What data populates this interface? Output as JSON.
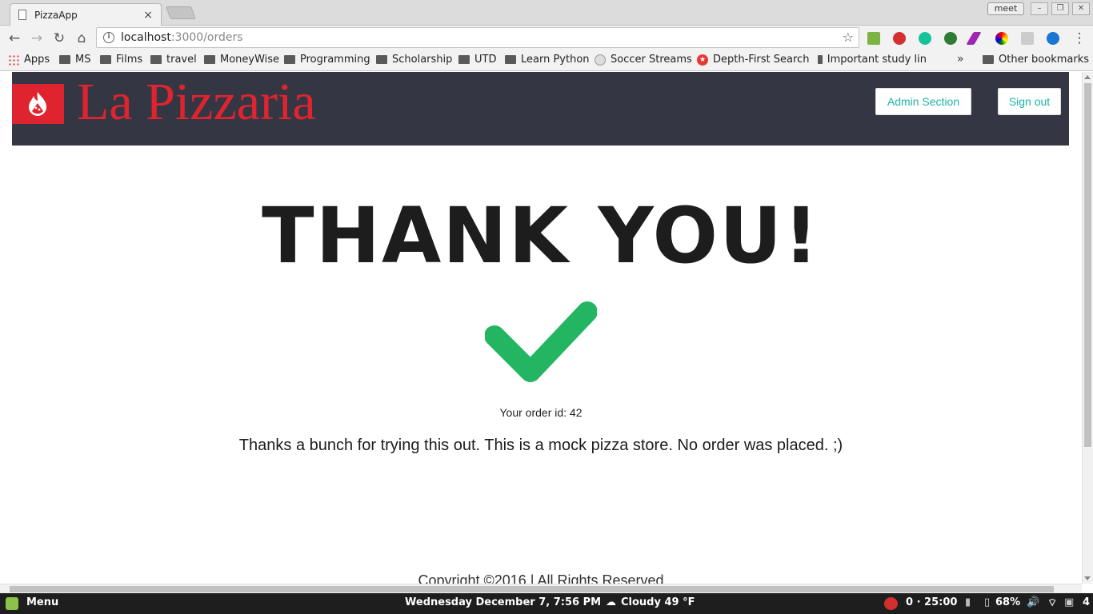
{
  "browser": {
    "tab_title": "PizzaApp",
    "tab_close": "×",
    "profile": "meet",
    "url_host": "localhost",
    "url_path": ":3000/orders",
    "bookmarks": [
      {
        "label": "Apps",
        "icon": "apps-icon"
      },
      {
        "label": "MS",
        "icon": "folder-icon"
      },
      {
        "label": "Films",
        "icon": "folder-icon"
      },
      {
        "label": "travel",
        "icon": "folder-icon"
      },
      {
        "label": "MoneyWise",
        "icon": "folder-icon"
      },
      {
        "label": "Programming",
        "icon": "folder-icon"
      },
      {
        "label": "Scholarship",
        "icon": "folder-icon"
      },
      {
        "label": "UTD",
        "icon": "folder-icon"
      },
      {
        "label": "Learn Python",
        "icon": "folder-icon"
      },
      {
        "label": "Soccer Streams",
        "icon": "reddit-icon"
      },
      {
        "label": "Depth-First Search",
        "icon": "star-red-icon"
      },
      {
        "label": "Important study lin",
        "icon": "folder-icon"
      }
    ],
    "bookmarks_more": "»",
    "other_bookmarks": "Other bookmarks"
  },
  "site": {
    "brand": "La Pizzaria",
    "admin_button": "Admin Section",
    "signout_button": "Sign out",
    "heading": "THANK YOU!",
    "order_id_label": "Your order id: 42",
    "message": "Thanks a bunch for trying this out. This is a mock pizza store. No order was placed. ;)",
    "copyright": "Copyright ©2016 | All Rights Reserved",
    "brand_color": "#e0242f",
    "header_color": "#343643",
    "accent_color": "#1bb3a8",
    "check_color": "#24b562"
  },
  "taskbar": {
    "menu": "Menu",
    "datetime": "Wednesday December  7,  7:56 PM",
    "weather": "Cloudy 49 °F",
    "pomodoro": "0 · 25:00",
    "battery": "68%",
    "workspace": "4"
  }
}
